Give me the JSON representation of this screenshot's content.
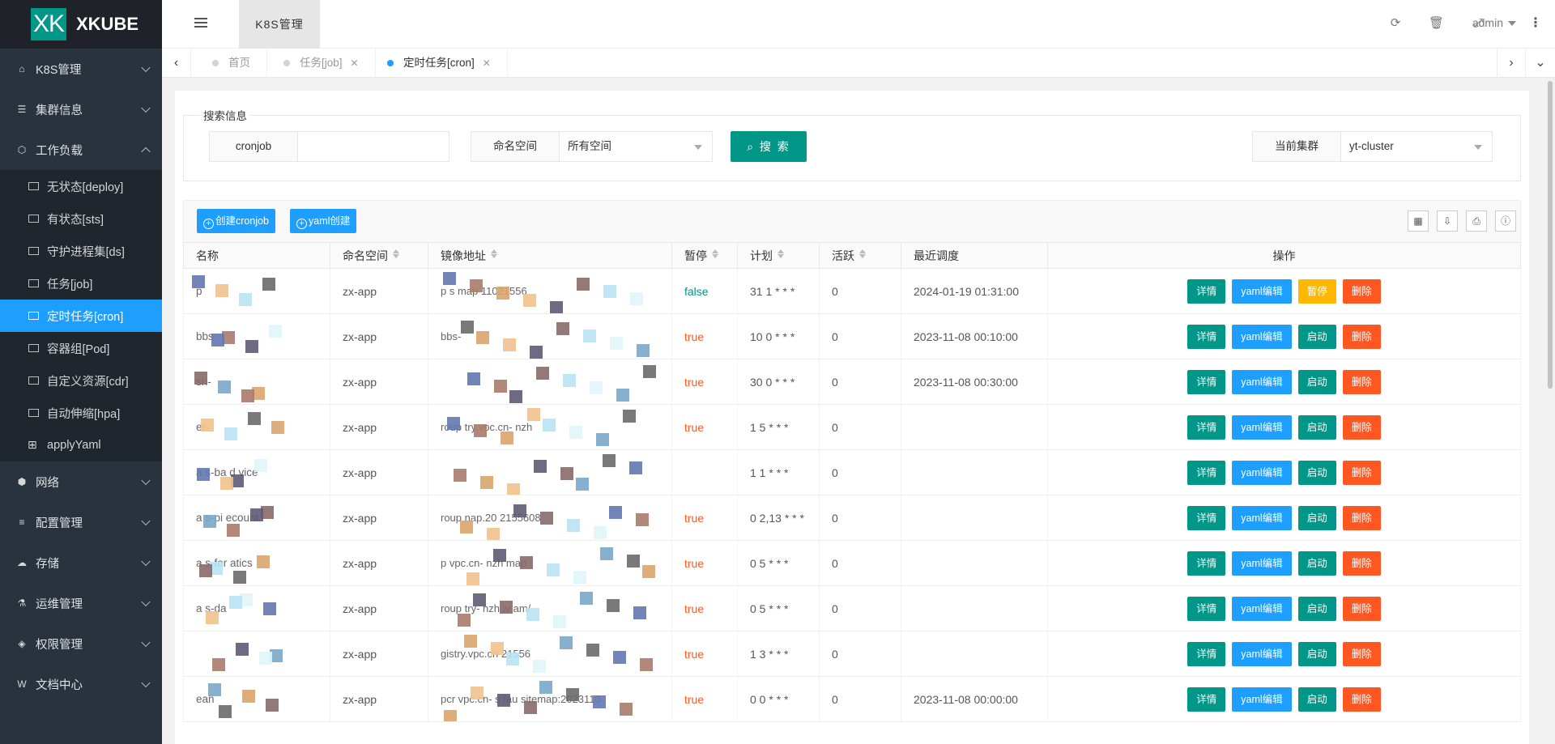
{
  "app": {
    "logo_mark": "XK",
    "logo_text": "XKUBE"
  },
  "header": {
    "tab": "K8S管理",
    "user": "admin"
  },
  "sidebar": {
    "items": [
      {
        "label": "K8S管理",
        "icon": "home-icon"
      },
      {
        "label": "集群信息",
        "icon": "server-icon"
      },
      {
        "label": "工作负载",
        "icon": "cube-icon"
      }
    ],
    "sub": [
      {
        "label": "无状态[deploy]"
      },
      {
        "label": "有状态[sts]"
      },
      {
        "label": "守护进程集[ds]"
      },
      {
        "label": "任务[job]"
      },
      {
        "label": "定时任务[cron]"
      },
      {
        "label": "容器组[Pod]"
      },
      {
        "label": "自定义资源[cdr]"
      },
      {
        "label": "自动伸缩[hpa]"
      },
      {
        "label": "applyYaml"
      }
    ],
    "items2": [
      {
        "label": "网络",
        "icon": "network-icon"
      },
      {
        "label": "配置管理",
        "icon": "database-icon"
      },
      {
        "label": "存储",
        "icon": "cloud-icon"
      },
      {
        "label": "运维管理",
        "icon": "flask-icon"
      },
      {
        "label": "权限管理",
        "icon": "shield-icon"
      },
      {
        "label": "文档中心",
        "icon": "book-icon"
      }
    ]
  },
  "tabs": [
    {
      "label": "首页"
    },
    {
      "label": "任务[job]"
    },
    {
      "label": "定时任务[cron]"
    }
  ],
  "search": {
    "legend": "搜索信息",
    "cronjob_label": "cronjob",
    "cronjob_value": "",
    "ns_label": "命名空间",
    "ns_value": "所有空间",
    "button": "搜 索",
    "cluster_label": "当前集群",
    "cluster_value": "yt-cluster"
  },
  "toolbar": {
    "create": "创建cronjob",
    "yaml_create": "yaml创建"
  },
  "table": {
    "headers": [
      "名称",
      "命名空间",
      "镜像地址",
      "暂停",
      "计划",
      "活跃",
      "最近调度",
      "操作"
    ],
    "ops": {
      "detail": "详情",
      "yaml": "yaml编辑",
      "pause": "暂停",
      "start": "启动",
      "delete": "删除"
    },
    "rows": [
      {
        "name": "p",
        "ns": "zx-app",
        "image": "p  s  map  11021556",
        "pause": "false",
        "schedule": "31 1 * * *",
        "active": "0",
        "last": "2024-01-19 01:31:00"
      },
      {
        "name": "bbs",
        "ns": "zx-app",
        "image": "bbs-",
        "pause": "true",
        "schedule": "10 0 * * *",
        "active": "0",
        "last": "2023-11-08 00:10:00"
      },
      {
        "name": "sh-",
        "ns": "zx-app",
        "image": "",
        "pause": "true",
        "schedule": "30 0 * * *",
        "active": "0",
        "last": "2023-11-08 00:30:00"
      },
      {
        "name": "er-",
        "ns": "zx-app",
        "image": "roup  try.vpc.cn-  nzh",
        "pause": "true",
        "schedule": "1 5 * * *",
        "active": "0",
        "last": ""
      },
      {
        "name": "a  s-ba  d  vice",
        "ns": "zx-app",
        "image": "",
        "pause": "",
        "schedule": "1 1 * * *",
        "active": "0",
        "last": ""
      },
      {
        "name": "a  s-pi  ecount",
        "ns": "zx-app",
        "image": "roup  nap.20  2155608",
        "pause": "true",
        "schedule": "0 2,13 * * *",
        "active": "0",
        "last": ""
      },
      {
        "name": "a  s-for  atics",
        "ns": "zx-app",
        "image": "p  vpc.cn-  nzh  map",
        "pause": "true",
        "schedule": "0 5 * * *",
        "active": "0",
        "last": ""
      },
      {
        "name": "a  s-da",
        "ns": "zx-app",
        "image": "roup  try-  nzh  iv  am/",
        "pause": "true",
        "schedule": "0 5 * * *",
        "active": "0",
        "last": ""
      },
      {
        "name": "",
        "ns": "zx-app",
        "image": "gistry.vpc.cn  21556",
        "pause": "true",
        "schedule": "1 3 * * *",
        "active": "0",
        "last": ""
      },
      {
        "name": "ean",
        "ns": "zx-app",
        "image": "pcr  vpc.cn-  s  /au  sitemap:2023110",
        "pause": "true",
        "schedule": "0 0 * * *",
        "active": "0",
        "last": "2023-11-08 00:00:00"
      }
    ]
  },
  "colors": {
    "sidebar_bg": "#28333e",
    "accent": "#009688",
    "blue": "#1e9fff",
    "warn": "#ffb800",
    "danger": "#ff5722"
  }
}
